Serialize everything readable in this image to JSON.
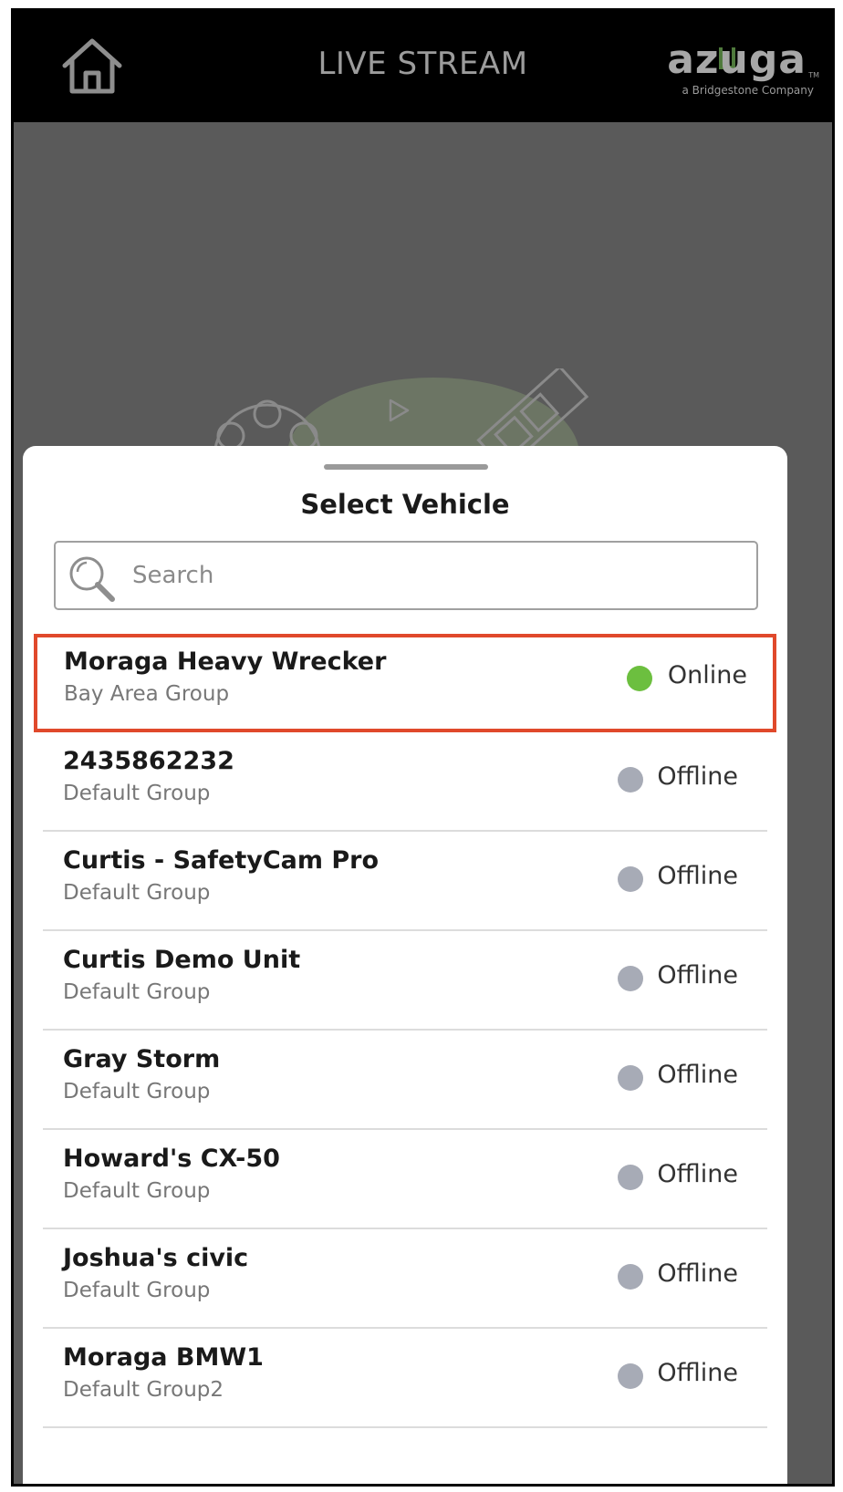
{
  "header": {
    "title": "LIVE STREAM",
    "home_icon": "home-icon",
    "logo_text": "azuga",
    "logo_tagline": "a Bridgestone Company",
    "logo_tm": "TM"
  },
  "sheet": {
    "title": "Select Vehicle",
    "search_placeholder": "Search"
  },
  "colors": {
    "online": "#6cbf3f",
    "offline": "#a7abb6",
    "selection_border": "#e0492b",
    "brand_green": "#4f7a3c"
  },
  "vehicles": [
    {
      "name": "Moraga Heavy Wrecker",
      "group": "Bay Area Group",
      "status": "Online",
      "selected": true
    },
    {
      "name": "2435862232",
      "group": "Default Group",
      "status": "Offline",
      "selected": false
    },
    {
      "name": "Curtis - SafetyCam Pro",
      "group": "Default Group",
      "status": "Offline",
      "selected": false
    },
    {
      "name": "Curtis Demo Unit",
      "group": "Default Group",
      "status": "Offline",
      "selected": false
    },
    {
      "name": "Gray Storm",
      "group": "Default Group",
      "status": "Offline",
      "selected": false
    },
    {
      "name": "Howard's CX-50",
      "group": "Default Group",
      "status": "Offline",
      "selected": false
    },
    {
      "name": "Joshua's civic",
      "group": "Default Group",
      "status": "Offline",
      "selected": false
    },
    {
      "name": "Moraga BMW1",
      "group": "Default Group2",
      "status": "Offline",
      "selected": false
    }
  ]
}
